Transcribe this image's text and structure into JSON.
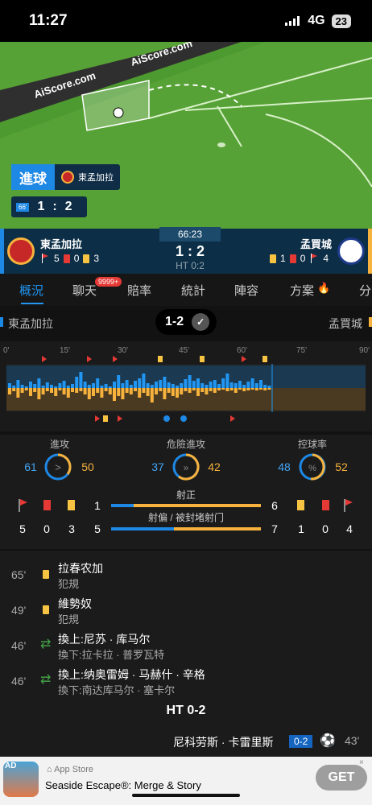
{
  "status_bar": {
    "time": "11:27",
    "network": "4G",
    "battery": "23"
  },
  "pitch": {
    "ad_text_1": "AiScore.com",
    "ad_text_2": "AiScore.com"
  },
  "goal_badge": {
    "label": "進球",
    "team": "東孟加拉"
  },
  "mini_score": {
    "minute": "66'",
    "home": "1",
    "sep": ":",
    "away": "2"
  },
  "match": {
    "home": {
      "name": "東孟加拉",
      "corners": "5",
      "red": "0",
      "yellow": "3"
    },
    "away": {
      "name": "孟買城",
      "corners": "4",
      "red": "0",
      "yellow": "1"
    },
    "clock": "66:23",
    "score": "1 : 2",
    "ht": "HT 0:2"
  },
  "tabs": [
    {
      "label": "概況"
    },
    {
      "label": "聊天"
    },
    {
      "label": "賠率"
    },
    {
      "label": "統計"
    },
    {
      "label": "陣容"
    },
    {
      "label": "方案"
    },
    {
      "label": "分"
    }
  ],
  "chat_badge": "9999+",
  "teamrow": {
    "home": "東孟加拉",
    "away": "孟買城",
    "score": "1-2"
  },
  "timeline": {
    "ticks": [
      "0'",
      "15'",
      "30'",
      "45'",
      "60'",
      "75'",
      "90'"
    ]
  },
  "stats": {
    "attack": {
      "label": "進攻",
      "home": "61",
      "away": "50"
    },
    "danger": {
      "label": "危險進攻",
      "home": "37",
      "away": "42"
    },
    "possession": {
      "label": "控球率",
      "home": "48",
      "away": "52"
    },
    "shots_on": {
      "label": "射正",
      "home": "1",
      "away": "6"
    },
    "shots_off": {
      "label": "射偏 / 被封堵射门",
      "home": "5",
      "away": "7"
    },
    "home_row1": {
      "corner": "",
      "red": "",
      "yellow": ""
    },
    "home_row2": {
      "corner": "5",
      "red": "0",
      "yellow": "3"
    },
    "away_row2": {
      "yellow": "1",
      "red": "0",
      "corner": "4"
    }
  },
  "events": [
    {
      "minute": "65'",
      "type": "yellow",
      "line1": "拉春农加",
      "line2": "犯規"
    },
    {
      "minute": "49'",
      "type": "yellow",
      "line1": "維勢奴",
      "line2": "犯規"
    },
    {
      "minute": "46'",
      "type": "sub",
      "line1": "換上:尼苏 · 库马尔",
      "line2": "換下:拉卡拉 · 普罗瓦特"
    },
    {
      "minute": "46'",
      "type": "sub",
      "line1": "換上:纳奥雷姆 · 马赫什 · 辛格",
      "line2": "換下:南达库马尔 · 塞卡尔"
    }
  ],
  "ht_label": "HT 0-2",
  "goal_event": {
    "player": "尼科劳斯 · 卡雷里斯",
    "score": "0-2",
    "minute": "43'"
  },
  "ad": {
    "tag": "AD",
    "store": "App Store",
    "title": "Seaside Escape®: Merge & Story",
    "cta": "GET"
  },
  "colors": {
    "home": "#1e88e5",
    "away": "#f6b23c"
  }
}
